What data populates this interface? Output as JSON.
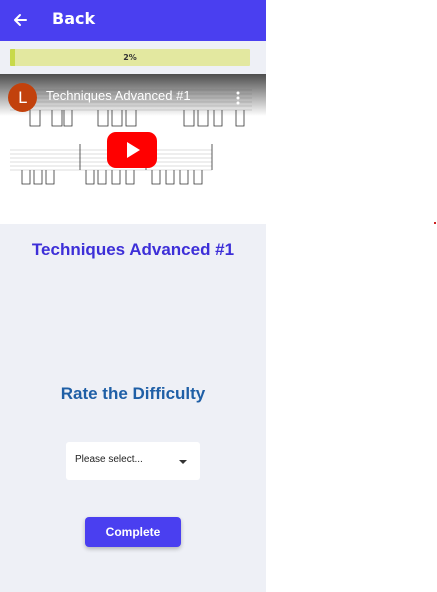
{
  "header": {
    "back_label": "Back",
    "back_icon": "arrow-left-icon"
  },
  "progress": {
    "percent": 2,
    "label": "2%"
  },
  "video": {
    "channel_initial": "L",
    "title": "Techniques Advanced #1",
    "play_icon": "youtube-play-icon",
    "menu_icon": "kebab-icon"
  },
  "lesson": {
    "title": "Techniques Advanced #1"
  },
  "rating": {
    "title": "Rate the Difficulty",
    "select_placeholder": "Please select..."
  },
  "actions": {
    "complete_label": "Complete"
  },
  "colors": {
    "primary": "#4a3ff0",
    "progress_fill": "#c8d94a",
    "progress_track": "#e3e8a0",
    "rate_title": "#1f5fa6",
    "youtube_red": "#ff0000"
  }
}
